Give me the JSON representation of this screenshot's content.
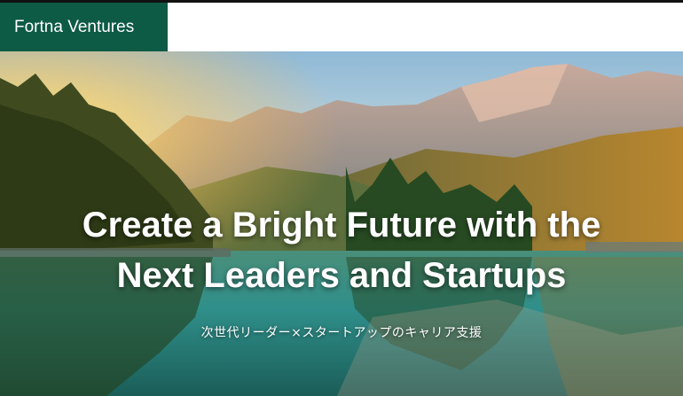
{
  "header": {
    "brand": "Fortna Ventures",
    "brand_color": "#0d5a45"
  },
  "hero": {
    "headline_line1": "Create a Bright Future with the",
    "headline_line2": "Next Leaders and Startups",
    "subtitle": "次世代リーダー×スタートアップのキャリア支援",
    "image_description_icon": "alpine-lake-landscape"
  }
}
